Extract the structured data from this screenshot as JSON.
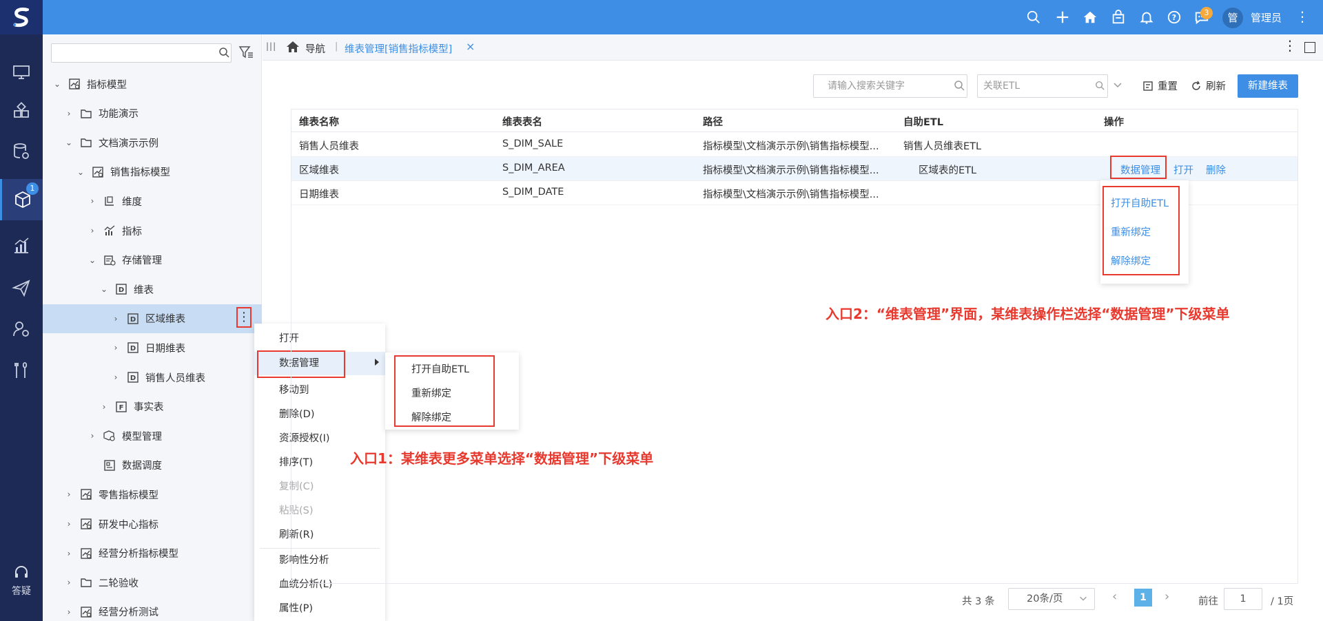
{
  "header": {
    "logo": "S",
    "username": "管理员",
    "avatar_text": "管",
    "chat_badge": "3",
    "icons": [
      "search-icon",
      "plus-icon",
      "home-icon",
      "shop-icon",
      "bell-icon",
      "help-icon",
      "chat-icon"
    ]
  },
  "leftnav": {
    "badge": "1",
    "help_label": "答疑",
    "items": [
      "monitor-icon",
      "blocks-icon",
      "database-gear-icon",
      "cube-icon",
      "chart-icon",
      "send-icon",
      "user-gear-icon",
      "tools-icon"
    ]
  },
  "tree": {
    "search_placeholder": "",
    "nodes": [
      {
        "label": "指标模型",
        "depth": 0,
        "caret": "⌄",
        "icon": "model-icon"
      },
      {
        "label": "功能演示",
        "depth": 1,
        "caret": "›",
        "icon": "folder-icon"
      },
      {
        "label": "文档演示示例",
        "depth": 1,
        "caret": "⌄",
        "icon": "folder-icon"
      },
      {
        "label": "销售指标模型",
        "depth": 2,
        "caret": "⌄",
        "icon": "model-icon"
      },
      {
        "label": "维度",
        "depth": 3,
        "caret": "›",
        "icon": "dimension-icon"
      },
      {
        "label": "指标",
        "depth": 3,
        "caret": "›",
        "icon": "metric-icon"
      },
      {
        "label": "存储管理",
        "depth": 3,
        "caret": "⌄",
        "icon": "storage-icon"
      },
      {
        "label": "维表",
        "depth": 4,
        "caret": "⌄",
        "icon": "d-table-icon"
      },
      {
        "label": "区域维表",
        "depth": 5,
        "caret": "›",
        "icon": "d-table-icon",
        "selected": true
      },
      {
        "label": "日期维表",
        "depth": 5,
        "caret": "›",
        "icon": "d-table-icon"
      },
      {
        "label": "销售人员维表",
        "depth": 5,
        "caret": "›",
        "icon": "d-table-icon"
      },
      {
        "label": "事实表",
        "depth": 4,
        "caret": "›",
        "icon": "f-table-icon"
      },
      {
        "label": "模型管理",
        "depth": 3,
        "caret": "›",
        "icon": "model-gear-icon"
      },
      {
        "label": "数据调度",
        "depth": 3,
        "caret": "",
        "icon": "schedule-icon"
      },
      {
        "label": "零售指标模型",
        "depth": 1,
        "caret": "›",
        "icon": "model-icon"
      },
      {
        "label": "研发中心指标",
        "depth": 1,
        "caret": "›",
        "icon": "model-icon"
      },
      {
        "label": "经营分析指标模型",
        "depth": 1,
        "caret": "›",
        "icon": "model-icon"
      },
      {
        "label": "二轮验收",
        "depth": 1,
        "caret": "›",
        "icon": "folder-icon"
      },
      {
        "label": "经营分析测试",
        "depth": 1,
        "caret": "›",
        "icon": "model-icon"
      }
    ]
  },
  "context_menu": {
    "items": [
      {
        "label": "打开"
      },
      {
        "label": "数据管理",
        "highlight": true
      },
      {
        "label": "移动到"
      },
      {
        "label": "删除(D)"
      },
      {
        "label": "资源授权(I)"
      },
      {
        "label": "排序(T)"
      },
      {
        "label": "复制(C)",
        "disabled": true
      },
      {
        "label": "粘贴(S)",
        "disabled": true
      },
      {
        "label": "刷新(R)"
      },
      {
        "label": "影响性分析"
      },
      {
        "label": "血统分析(L)"
      },
      {
        "label": "属性(P)"
      }
    ],
    "submenu": [
      "打开自助ETL",
      "重新绑定",
      "解除绑定"
    ]
  },
  "tabs": {
    "nav_label": "导航",
    "active_label": "维表管理[销售指标模型]",
    "close": "×"
  },
  "toolbar": {
    "search_placeholder": "请输入搜索关键字",
    "etl_placeholder": "关联ETL",
    "reset_label": "重置",
    "refresh_label": "刷新",
    "new_label": "新建维表"
  },
  "table": {
    "columns": [
      "维表名称",
      "维表表名",
      "路径",
      "自助ETL",
      "操作"
    ],
    "rows": [
      {
        "name": "销售人员维表",
        "table": "S_DIM_SALE",
        "path": "指标模型\\文档演示示例\\销售指标模型...",
        "etl": "销售人员维表ETL",
        "ops": []
      },
      {
        "name": "区域维表",
        "table": "S_DIM_AREA",
        "path": "指标模型\\文档演示示例\\销售指标模型...",
        "etl": "区域表的ETL",
        "ops": [
          "数据管理",
          "打开",
          "删除"
        ]
      },
      {
        "name": "日期维表",
        "table": "S_DIM_DATE",
        "path": "指标模型\\文档演示示例\\销售指标模型...",
        "etl": "",
        "ops": []
      }
    ],
    "op_dropdown": [
      "打开自助ETL",
      "重新绑定",
      "解除绑定"
    ]
  },
  "annotations": {
    "entry1": "入口1：某维表更多菜单选择“数据管理”下级菜单",
    "entry2": "入口2：“维表管理”界面，某维表操作栏选择“数据管理”下级菜单"
  },
  "pagination": {
    "total": "共 3 条",
    "page_size": "20条/页",
    "current_page": "1",
    "goto_label": "前往",
    "goto_value": "1",
    "pages_label": "/ 1页"
  },
  "colors": {
    "header_bg": "#3d8ee4",
    "nav_bg": "#1d2a55",
    "accent": "#3d8ee4",
    "annotation_red": "#e8392e"
  }
}
